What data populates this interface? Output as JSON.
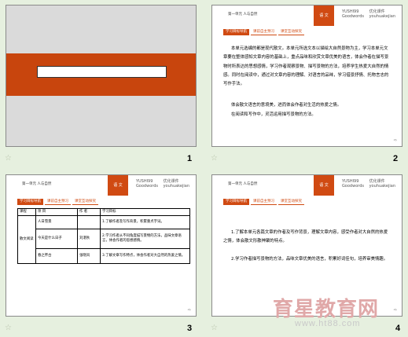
{
  "slides": [
    {
      "number": "1",
      "title_box_text": ""
    },
    {
      "number": "2",
      "header_left": "第一单元 人与自然",
      "logo_text": "语 文",
      "brand_top": "YUSHI99",
      "brand_bottom": "Goodwords",
      "brand2_top": "优化课件",
      "brand2_bottom": "youhuakejian",
      "tabs": [
        "学习目标导航",
        "课前自主预习",
        "课堂互动探究"
      ],
      "paragraphs": [
        "本单元选编的都是现代散文。本单元所选文本以描绘大自然景物为主，学习本单元文章要在整体感知文章内容的基础上，重点品味和欣赏文章优美的语言，体会作者在描写景物时所表达的思想感情，学习作者观察景物、描写景物的方法，培养学生热爱大自然的情感。同时在阅读中，通过对文章内容的理解、对语言的品味，学习借景抒情、托物言志的写作手法。",
        "体会散文语言的意境美，进而体会作者对生活的热爱之情。",
        "在阅读和写作中，灵活运用描写景物的方法。"
      ]
    },
    {
      "number": "3",
      "header_left": "第一单元 人与自然",
      "logo_text": "语 文",
      "brand_top": "YUSHI99",
      "brand_bottom": "Goodwords",
      "brand2_top": "优化课件",
      "brand2_bottom": "youhuakejian",
      "tabs": [
        "学习目标导航",
        "课前自主预习",
        "课堂互动探究"
      ],
      "table": {
        "headers": [
          "课程",
          "项 目",
          "作 者",
          "学习目标"
        ],
        "group_label": "散文阅读",
        "rows": [
          {
            "item": "人日雪景",
            "author": "",
            "goal": "1.了解作者及写作背景，积累重点字词。"
          },
          {
            "item": "今天是什么日子",
            "author": "刘湛秋",
            "goal": "2.学习作者从不同角度描写景物的方法，品味文章语言，体会作者的思想感情。"
          },
          {
            "item": "春之怀古",
            "author": "张晓风",
            "goal": "3.了解文章写作特点，体会作者对大自然的热爱之情。"
          }
        ]
      }
    },
    {
      "number": "4",
      "header_left": "第一单元 人与自然",
      "logo_text": "语 文",
      "brand_top": "YUSHI99",
      "brand_bottom": "Goodwords",
      "brand2_top": "优化课件",
      "brand2_bottom": "youhuakejian",
      "tabs": [
        "学习目标导航",
        "课前自主预习",
        "课堂互动探究"
      ],
      "paragraphs": [
        "1.了解本单元各篇文章的作者及写作背景，理解文章内容，感受作者对大自然的热爱之情，体会散文形散神聚的特点。",
        "2.学习作者描写景物的方法，品味文章优美的语言，积累好词佳句，培养审美情趣。"
      ]
    }
  ],
  "watermark": {
    "text": "育星教育网",
    "url": "www.ht88.com"
  }
}
